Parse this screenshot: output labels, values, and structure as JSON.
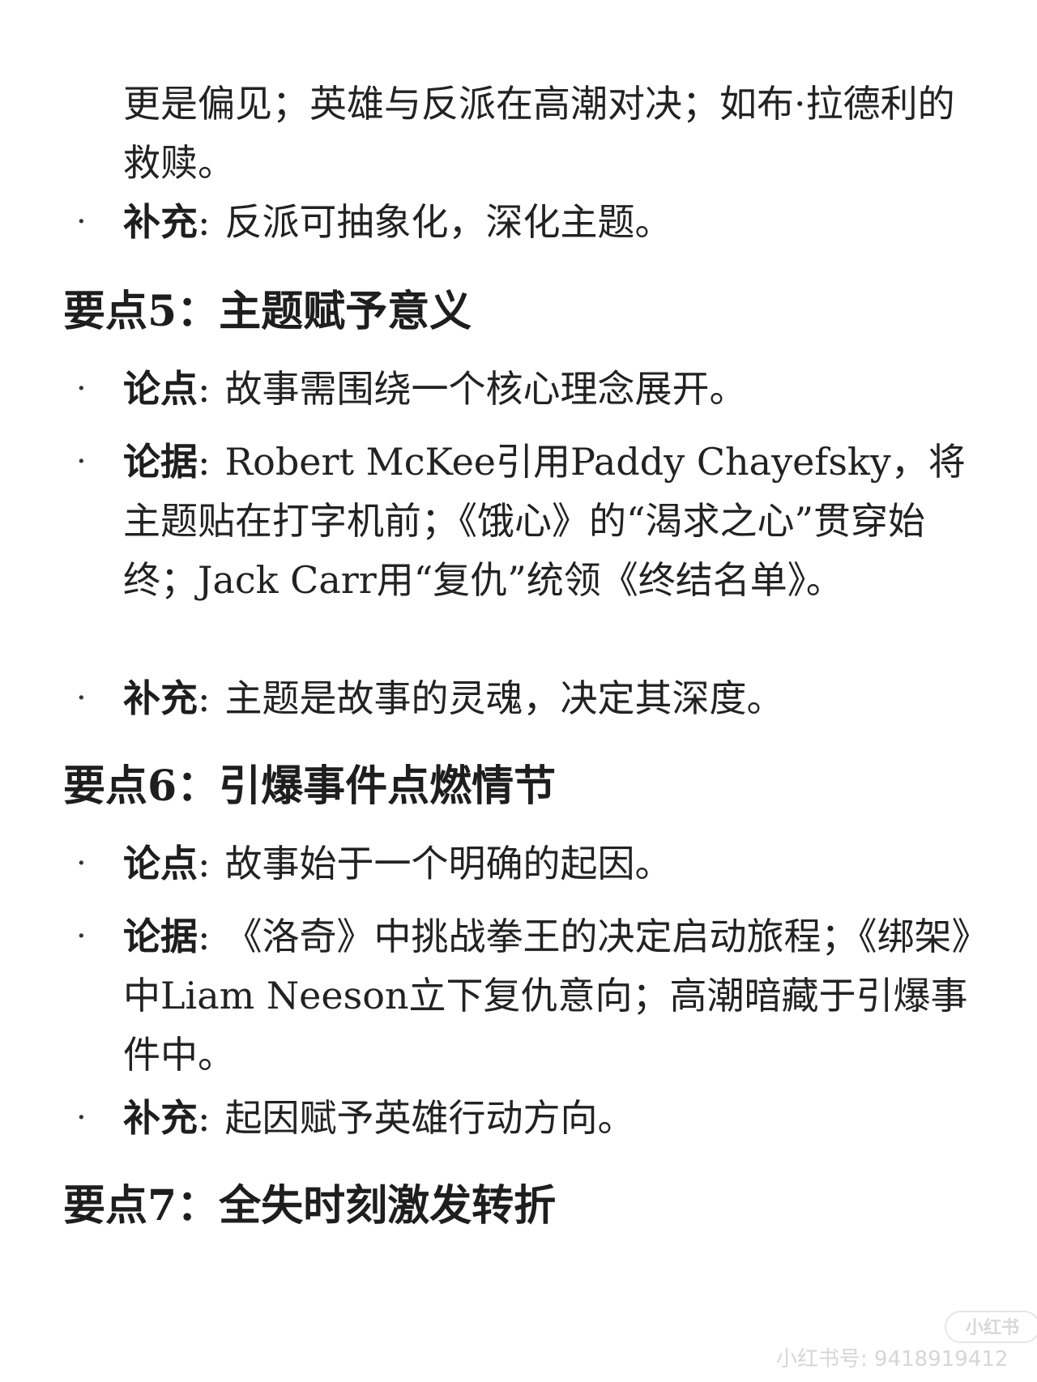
{
  "continuation": "更是偏见；英雄与反派在高潮对决；如布·拉德利的救赎。",
  "bullet_char": "·",
  "top_item": {
    "label": "补充",
    "sep": ":",
    "text": "反派可抽象化，深化主题。"
  },
  "sections": [
    {
      "heading": "要点5：主题赋予意义",
      "items": [
        {
          "label": "论点",
          "sep": ":",
          "text": "故事需围绕一个核心理念展开。"
        },
        {
          "label": "论据",
          "sep": ":",
          "text": "Robert McKee引用Paddy Chayefsky，将主题贴在打字机前；《饿心》的“渴求之心”贯穿始终；Jack Carr用“复仇”统领《终结名单》。"
        },
        {
          "label": "补充",
          "sep": ":",
          "text": "主题是故事的灵魂，决定其深度。"
        }
      ]
    },
    {
      "heading": "要点6：引爆事件点燃情节",
      "items": [
        {
          "label": "论点",
          "sep": ":",
          "text": "故事始于一个明确的起因。"
        },
        {
          "label": "论据",
          "sep": ":",
          "text": "《洛奇》中挑战拳王的决定启动旅程；《绑架》中Liam Neeson立下复仇意向；高潮暗藏于引爆事件中。"
        },
        {
          "label": "补充",
          "sep": ":",
          "text": "起因赋予英雄行动方向。"
        }
      ]
    },
    {
      "heading": "要点7：全失时刻激发转折",
      "items": []
    }
  ],
  "watermark": {
    "logo": "小红书",
    "id_text": "小红书号: 9418919412"
  }
}
